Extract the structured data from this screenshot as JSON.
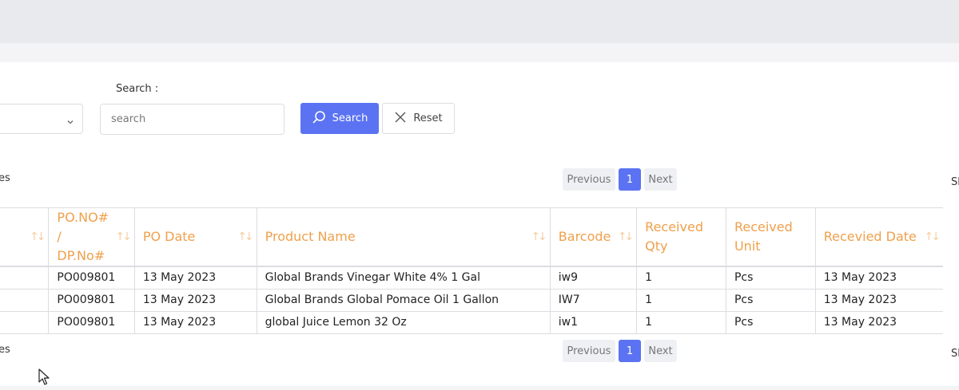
{
  "filters": {
    "search_label": "Search :",
    "search_placeholder": "search",
    "search_button": "Search",
    "reset_button": "Reset"
  },
  "pagination": {
    "entries_text": "tries",
    "side_text": "Sl",
    "previous": "Previous",
    "current_page": "1",
    "next": "Next"
  },
  "table": {
    "headers": [
      "",
      "PO.NO# / DP.No#",
      "PO Date",
      "Product Name",
      "Barcode",
      "Received Qty",
      "Received Unit",
      "Recevied Date"
    ],
    "rows": [
      [
        "",
        "PO009801",
        "13 May 2023",
        "Global Brands Vinegar White 4% 1 Gal",
        "iw9",
        "1",
        "Pcs",
        "13 May 2023"
      ],
      [
        "",
        "PO009801",
        "13 May 2023",
        "Global Brands Global Pomace Oil 1 Gallon",
        "IW7",
        "1",
        "Pcs",
        "13 May 2023"
      ],
      [
        "",
        "PO009801",
        "13 May 2023",
        "global Juice Lemon 32 Oz",
        "iw1",
        "1",
        "Pcs",
        "13 May 2023"
      ]
    ]
  },
  "theme": {
    "accent": "#5b73f2",
    "header_text": "#f0a04b"
  }
}
